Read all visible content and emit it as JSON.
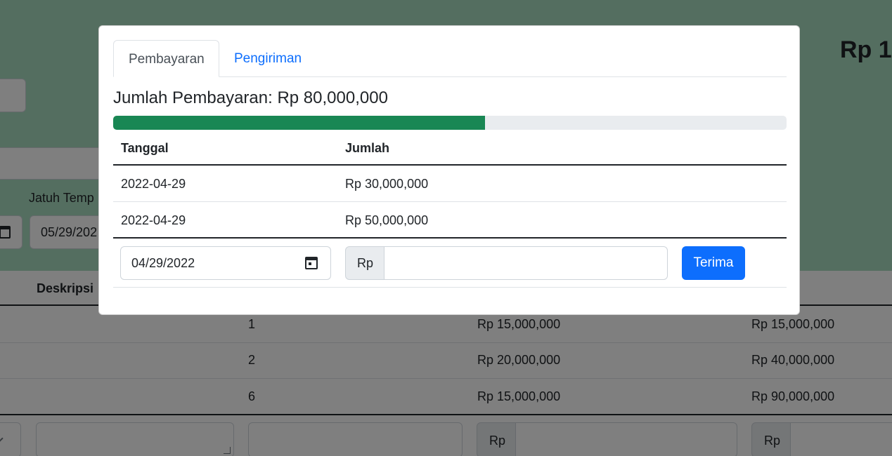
{
  "background": {
    "total_partial": "Rp 1",
    "due_date_label": "Jatuh Temp",
    "due_date_value": "05/29/202",
    "table_headers": {
      "description": "Deskripsi"
    },
    "rows": [
      {
        "qty": "1",
        "price": "Rp 15,000,000",
        "subtotal": "Rp 15,000,000"
      },
      {
        "qty": "2",
        "price": "Rp 20,000,000",
        "subtotal": "Rp 40,000,000"
      },
      {
        "qty": "6",
        "price": "Rp 15,000,000",
        "subtotal": "Rp 90,000,000"
      }
    ],
    "currency_prefix": "Rp"
  },
  "modal": {
    "tabs": [
      {
        "label": "Pembayaran",
        "active": true
      },
      {
        "label": "Pengiriman",
        "active": false
      }
    ],
    "payment_heading": "Jumlah Pembayaran: Rp 80,000,000",
    "progress_fraction": 0.5522,
    "progress_color": "#198754",
    "table": {
      "headers": {
        "date": "Tanggal",
        "amount": "Jumlah"
      },
      "rows": [
        {
          "date": "2022-04-29",
          "amount": "Rp 30,000,000"
        },
        {
          "date": "2022-04-29",
          "amount": "Rp 50,000,000"
        }
      ]
    },
    "form": {
      "date_value": "04/29/2022",
      "currency_addon": "Rp",
      "amount_value": "",
      "submit_label": "Terima"
    }
  },
  "colors": {
    "primary": "#0d6efd",
    "header_bg": "#a9dcc0"
  },
  "icons": {
    "calendar": "calendar-icon",
    "chevron": "chevron-down-icon"
  }
}
